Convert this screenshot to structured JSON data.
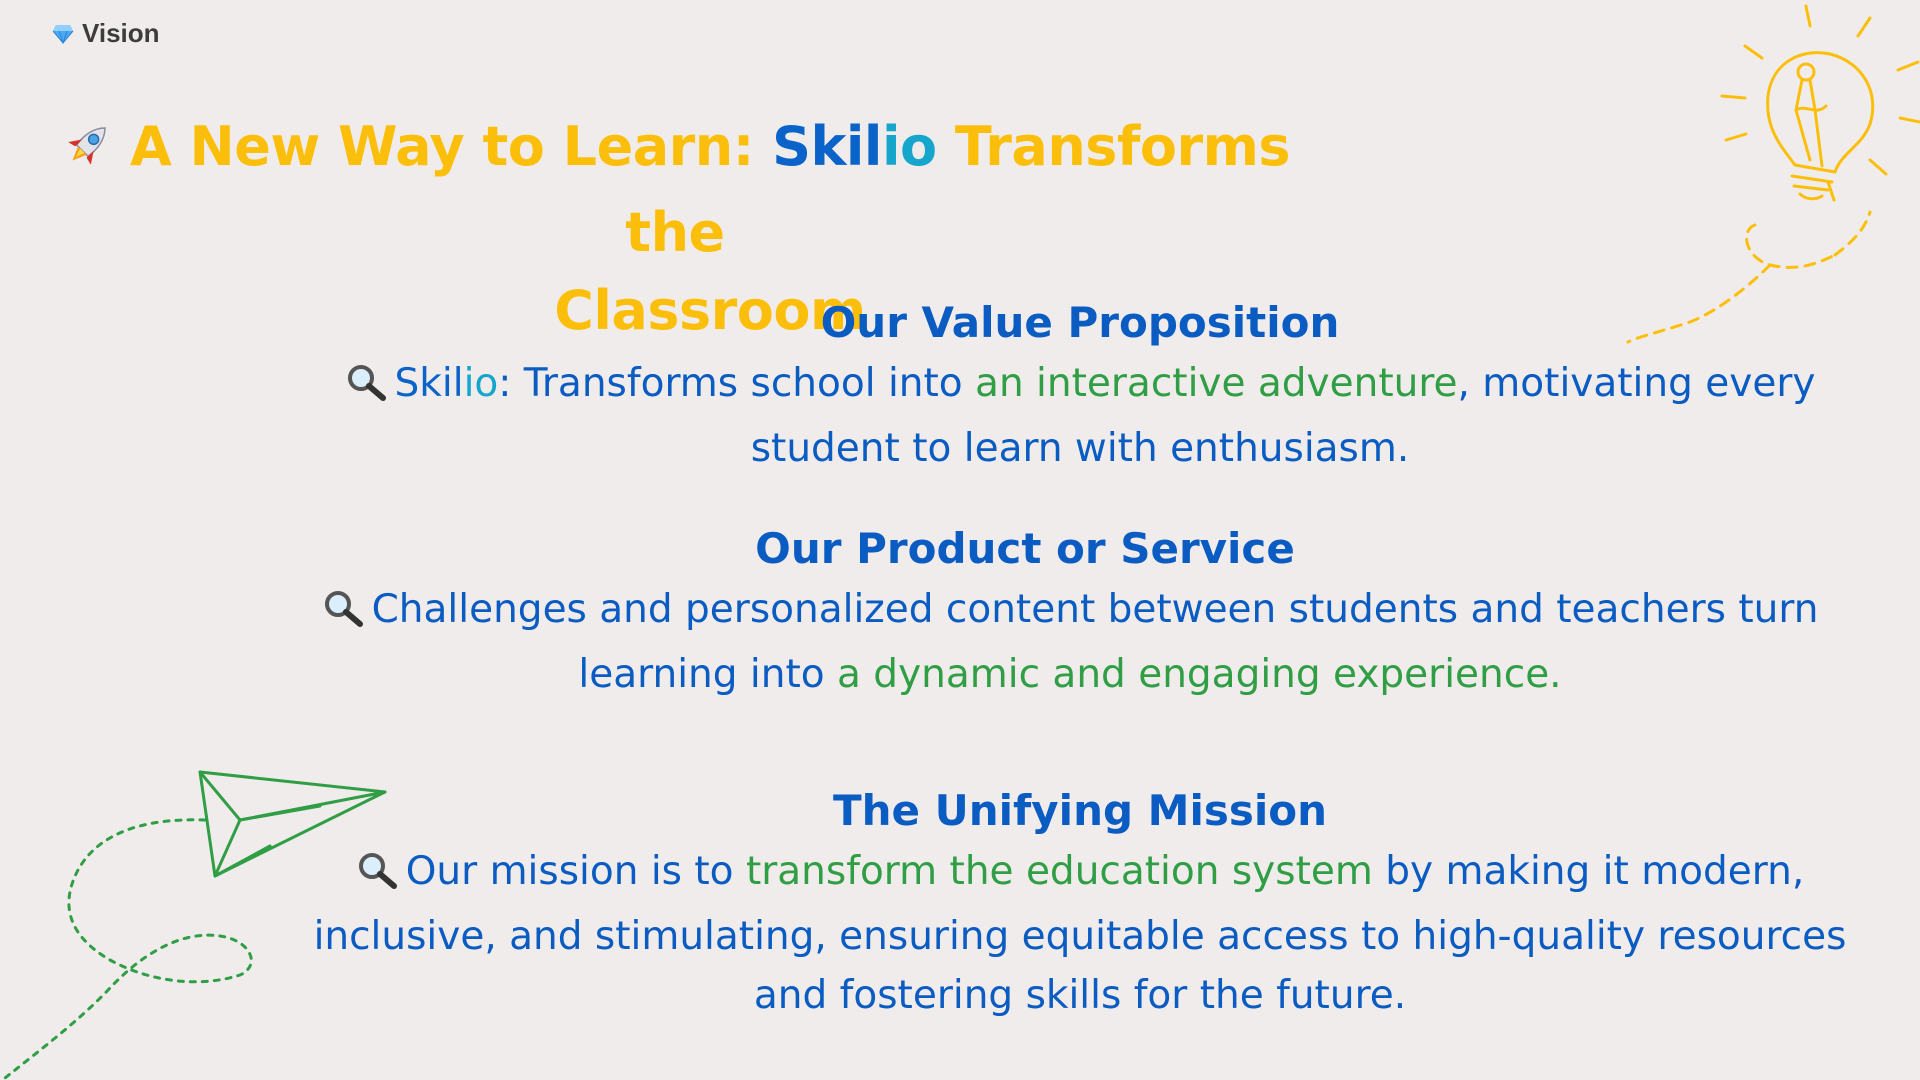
{
  "tag": {
    "icon": "gem-icon",
    "label": "Vision"
  },
  "title": {
    "icon": "rocket-icon",
    "part1": "A New Way to Learn: ",
    "brand_a": "Skil",
    "brand_b": "io",
    "part2": " Transforms the",
    "line2": "Classroom"
  },
  "sections": [
    {
      "heading": "Our Value Proposition",
      "icon": "magnifier-icon",
      "brand_a": "Skil",
      "brand_b": "io",
      "text1": ": Transforms school into ",
      "highlight": "an interactive adventure",
      "text2": ", motivating every student to learn with enthusiasm."
    },
    {
      "heading": "Our Product or Service",
      "icon": "magnifier-icon",
      "text1": "Challenges and personalized content between students and teachers turn learning into ",
      "highlight": "a dynamic and engaging experience."
    },
    {
      "heading": "The Unifying Mission",
      "icon": "magnifier-icon",
      "text1": "Our mission is to ",
      "highlight": "transform the education system",
      "text2": " by making it modern, inclusive, and stimulating, ensuring equitable access to high-quality resources and fostering skills for the future."
    }
  ],
  "colors": {
    "background": "#f1ecec",
    "title": "#fbbf0b",
    "heading": "#0a5bc2",
    "highlight": "#2f9e44",
    "brand_teal": "#16a6cc",
    "decoration_yellow": "#fbbf0b",
    "decoration_green": "#2f9e44"
  },
  "decorations": [
    "lightbulb-icon",
    "paper-plane-icon"
  ]
}
